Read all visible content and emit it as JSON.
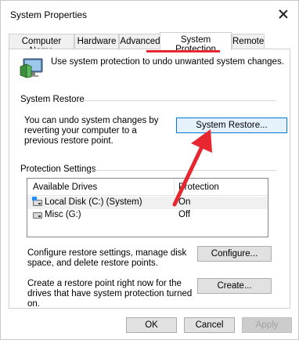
{
  "window": {
    "title": "System Properties"
  },
  "tabs": [
    {
      "label": "Computer Name"
    },
    {
      "label": "Hardware"
    },
    {
      "label": "Advanced"
    },
    {
      "label": "System Protection"
    },
    {
      "label": "Remote"
    }
  ],
  "active_tab": "System Protection",
  "intro": {
    "text": "Use system protection to undo unwanted system changes."
  },
  "system_restore": {
    "title": "System Restore",
    "text": "You can undo system changes by reverting your computer to a previous restore point.",
    "button": "System Restore..."
  },
  "protection_settings": {
    "title": "Protection Settings",
    "columns": [
      "Available Drives",
      "Protection"
    ],
    "drives": [
      {
        "name": "Local Disk (C:) (System)",
        "protection": "On"
      },
      {
        "name": "Misc (G:)",
        "protection": "Off"
      }
    ],
    "configure_text": "Configure restore settings, manage disk space, and delete restore points.",
    "configure_button": "Configure...",
    "create_text": "Create a restore point right now for the drives that have system protection turned on.",
    "create_button": "Create..."
  },
  "footer": {
    "ok": "OK",
    "cancel": "Cancel",
    "apply": "Apply"
  },
  "icons": {
    "close": "close-icon",
    "system_protection": "system-protection-icon",
    "drive": "drive-icon"
  },
  "colors": {
    "annotation": "#e8262f",
    "focus_border": "#0078d7"
  }
}
